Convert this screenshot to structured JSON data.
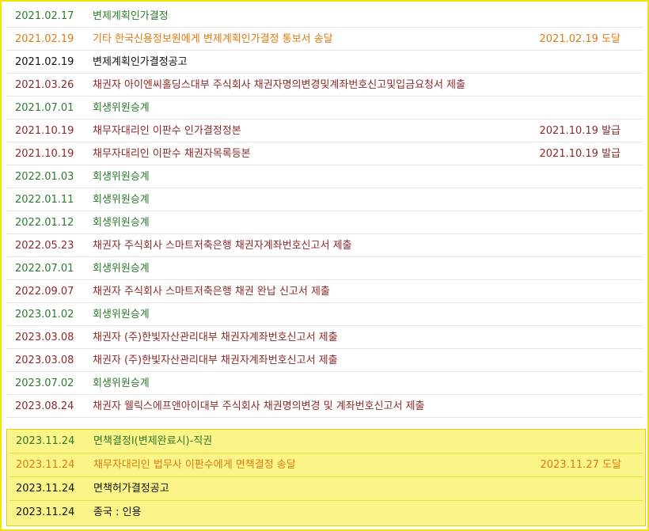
{
  "colors": {
    "green": "#2e7a2e",
    "orange": "#e07a10",
    "black": "#111111",
    "maroon": "#8b2a2a",
    "highlight": "#fbf489",
    "frame": "#f2e300"
  },
  "rows": [
    {
      "date": "2021.02.17",
      "desc": "변제계획인가결정",
      "note": "",
      "color": "green"
    },
    {
      "date": "2021.02.19",
      "desc": "기타 한국신용정보원에게 변제계획인가결정 통보서 송달",
      "note": "2021.02.19 도달",
      "color": "orange"
    },
    {
      "date": "2021.02.19",
      "desc": "변제계획인가결정공고",
      "note": "",
      "color": "black"
    },
    {
      "date": "2021.03.26",
      "desc": "채권자 아이엔씨홀딩스대부 주식회사 채권자명의변경및계좌번호신고및입금요청서 제출",
      "note": "",
      "color": "maroon"
    },
    {
      "date": "2021.07.01",
      "desc": "회생위원승계",
      "note": "",
      "color": "green"
    },
    {
      "date": "2021.10.19",
      "desc": "채무자대리인 이판수 인가결정정본",
      "note": "2021.10.19 발급",
      "color": "maroon"
    },
    {
      "date": "2021.10.19",
      "desc": "채무자대리인 이판수 채권자목록등본",
      "note": "2021.10.19 발급",
      "color": "maroon"
    },
    {
      "date": "2022.01.03",
      "desc": "회생위원승계",
      "note": "",
      "color": "green"
    },
    {
      "date": "2022.01.11",
      "desc": "회생위원승계",
      "note": "",
      "color": "green"
    },
    {
      "date": "2022.01.12",
      "desc": "회생위원승계",
      "note": "",
      "color": "green"
    },
    {
      "date": "2022.05.23",
      "desc": "채권자 주식회사 스마트저축은행 채권자계좌번호신고서 제출",
      "note": "",
      "color": "maroon"
    },
    {
      "date": "2022.07.01",
      "desc": "회생위원승계",
      "note": "",
      "color": "green"
    },
    {
      "date": "2022.09.07",
      "desc": "채권자 주식회사 스마트저축은행 채권 완납 신고서 제출",
      "note": "",
      "color": "maroon"
    },
    {
      "date": "2023.01.02",
      "desc": "회생위원승계",
      "note": "",
      "color": "green"
    },
    {
      "date": "2023.03.08",
      "desc": "채권자 (주)한빛자산관리대부 채권자계좌번호신고서 제출",
      "note": "",
      "color": "maroon"
    },
    {
      "date": "2023.03.08",
      "desc": "채권자 (주)한빛자산관리대부 채권자계좌번호신고서 제출",
      "note": "",
      "color": "maroon"
    },
    {
      "date": "2023.07.02",
      "desc": "회생위원승계",
      "note": "",
      "color": "green"
    },
    {
      "date": "2023.08.24",
      "desc": "채권자 웰릭스에프앤아이대부 주식회사 채권명의변경 및 계좌번호신고서 제출",
      "note": "",
      "color": "maroon"
    }
  ],
  "highlighted_rows": [
    {
      "date": "2023.11.24",
      "desc": "면책결정I(변제완료시)-직권",
      "note": "",
      "color": "green"
    },
    {
      "date": "2023.11.24",
      "desc": "채무자대리인 법무사 이판수에게 면책결정 송달",
      "note": "2023.11.27 도달",
      "color": "orange"
    },
    {
      "date": "2023.11.24",
      "desc": "면책허가결정공고",
      "note": "",
      "color": "black"
    },
    {
      "date": "2023.11.24",
      "desc": "종국 : 인용",
      "note": "",
      "color": "black"
    }
  ]
}
